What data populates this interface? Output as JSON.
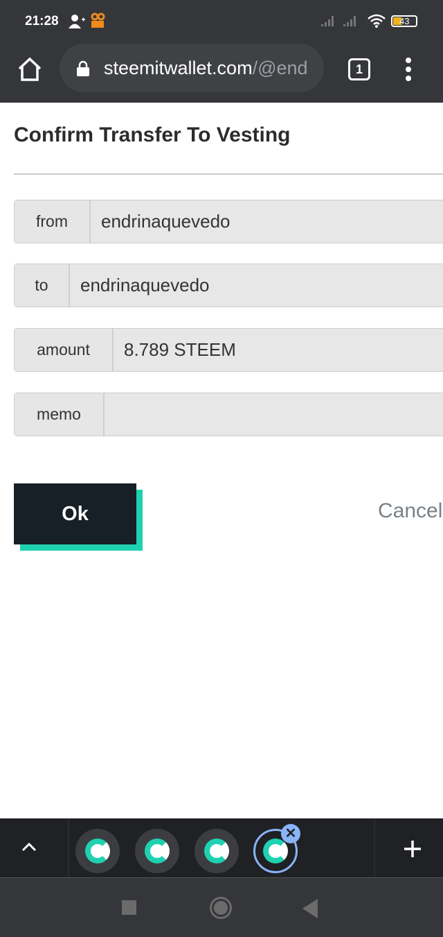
{
  "status_bar": {
    "time": "21:28",
    "battery": "43"
  },
  "browser": {
    "url_host": "steemitwallet.com",
    "url_path": "/@end",
    "tab_count": "1"
  },
  "dialog": {
    "title": "Confirm Transfer To Vesting",
    "fields": [
      {
        "label": "from",
        "value": "endrinaquevedo"
      },
      {
        "label": "to",
        "value": "endrinaquevedo"
      },
      {
        "label": "amount",
        "value": "8.789 STEEM"
      },
      {
        "label": "memo",
        "value": ""
      }
    ],
    "ok_label": "Ok",
    "cancel_label": "Cancel"
  },
  "colors": {
    "accent": "#1fd1b1",
    "button": "#171f27",
    "chrome": "#35363a"
  }
}
